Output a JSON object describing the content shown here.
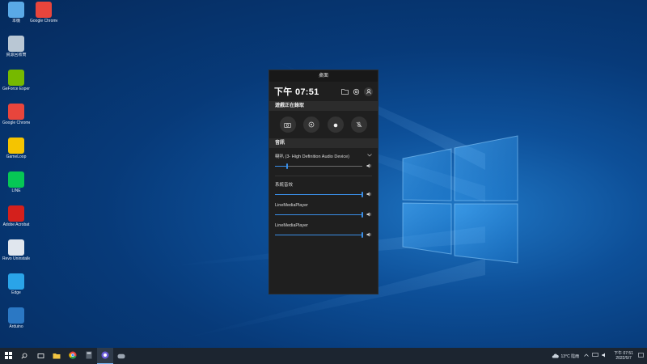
{
  "desktop": {
    "icons": [
      {
        "label": "本機",
        "icon": "this-pc-icon",
        "color": "#5aa9e6"
      },
      {
        "label": "Google Chrome",
        "icon": "chrome-icon",
        "color": "#e8453c"
      },
      {
        "label": "資源回收筒",
        "icon": "recycle-bin-icon",
        "color": "#b9c7d4"
      },
      {
        "label": "GeForce Experience",
        "icon": "nvidia-icon",
        "color": "#76b900"
      },
      {
        "label": "Google Chrome",
        "icon": "chrome-icon",
        "color": "#e8453c"
      },
      {
        "label": "GameLoop",
        "icon": "gameloop-icon",
        "color": "#f5c400"
      },
      {
        "label": "LINE",
        "icon": "line-icon",
        "color": "#06c755"
      },
      {
        "label": "Adobe Acrobat",
        "icon": "acrobat-icon",
        "color": "#d4201c"
      },
      {
        "label": "Revo Uninstaller",
        "icon": "revo-icon",
        "color": "#e0e6ee"
      },
      {
        "label": "Edge",
        "icon": "edge-icon",
        "color": "#2aa4e8"
      },
      {
        "label": "Arduino",
        "icon": "arduino-icon",
        "color": "#2b78c4"
      }
    ]
  },
  "gamebar": {
    "window_title": "桌面",
    "time": "下午 07:51",
    "capture": {
      "header": "遊戲正在錄取",
      "buttons": [
        {
          "icon": "camera-icon"
        },
        {
          "icon": "record-last-icon"
        },
        {
          "icon": "record-dot-icon"
        },
        {
          "icon": "mic-off-icon"
        }
      ]
    },
    "audio": {
      "header": "音訊",
      "device": "喇叭 (3- High Definition Audio Device)",
      "device_volume": 0.14,
      "apps": [
        {
          "name": "系統音效",
          "volume": 1.0
        },
        {
          "name": "LineMediaPlayer",
          "volume": 1.0
        },
        {
          "name": "LineMediaPlayer",
          "volume": 1.0
        }
      ]
    }
  },
  "taskbar": {
    "weather": "13°C 陰雨",
    "clock_time": "下午 07:51",
    "clock_date": "2022/5/7",
    "accent": "#1c2530"
  }
}
